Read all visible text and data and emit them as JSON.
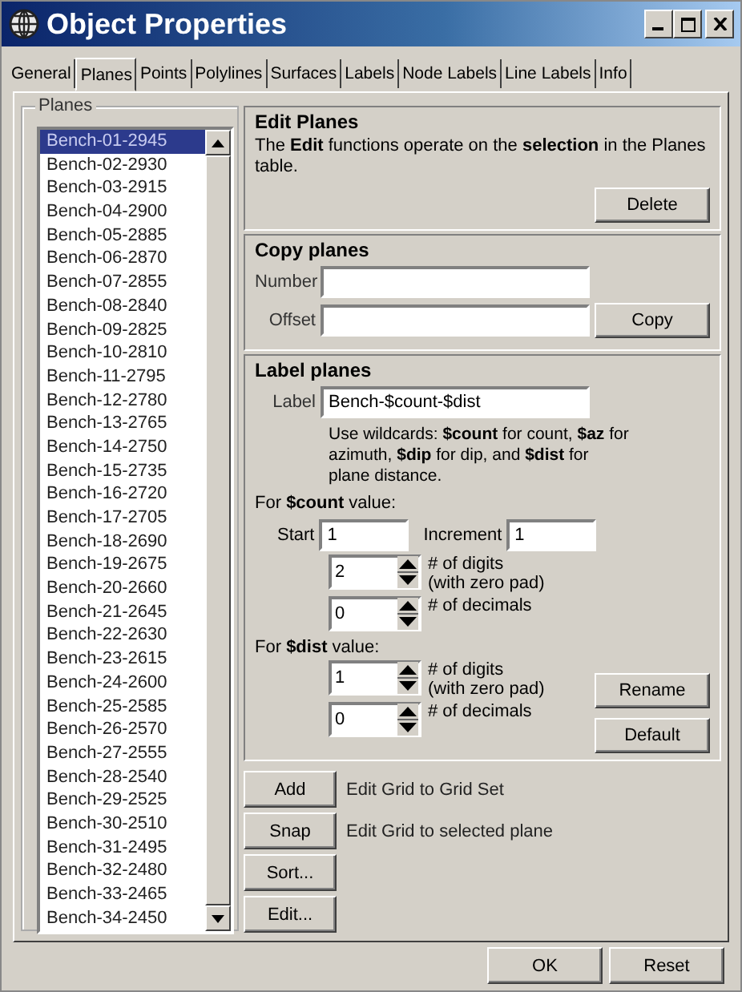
{
  "window": {
    "title": "Object Properties"
  },
  "tabs": [
    {
      "label": "General",
      "selected": false
    },
    {
      "label": "Planes",
      "selected": true
    },
    {
      "label": "Points",
      "selected": false
    },
    {
      "label": "Polylines",
      "selected": false
    },
    {
      "label": "Surfaces",
      "selected": false
    },
    {
      "label": "Labels",
      "selected": false
    },
    {
      "label": "Node Labels",
      "selected": false
    },
    {
      "label": "Line Labels",
      "selected": false
    },
    {
      "label": "Info",
      "selected": false
    }
  ],
  "planes_group": {
    "title": "Planes",
    "items": [
      {
        "label": "Bench-01-2945",
        "selected": true
      },
      {
        "label": "Bench-02-2930",
        "selected": false
      },
      {
        "label": "Bench-03-2915",
        "selected": false
      },
      {
        "label": "Bench-04-2900",
        "selected": false
      },
      {
        "label": "Bench-05-2885",
        "selected": false
      },
      {
        "label": "Bench-06-2870",
        "selected": false
      },
      {
        "label": "Bench-07-2855",
        "selected": false
      },
      {
        "label": "Bench-08-2840",
        "selected": false
      },
      {
        "label": "Bench-09-2825",
        "selected": false
      },
      {
        "label": "Bench-10-2810",
        "selected": false
      },
      {
        "label": "Bench-11-2795",
        "selected": false
      },
      {
        "label": "Bench-12-2780",
        "selected": false
      },
      {
        "label": "Bench-13-2765",
        "selected": false
      },
      {
        "label": "Bench-14-2750",
        "selected": false
      },
      {
        "label": "Bench-15-2735",
        "selected": false
      },
      {
        "label": "Bench-16-2720",
        "selected": false
      },
      {
        "label": "Bench-17-2705",
        "selected": false
      },
      {
        "label": "Bench-18-2690",
        "selected": false
      },
      {
        "label": "Bench-19-2675",
        "selected": false
      },
      {
        "label": "Bench-20-2660",
        "selected": false
      },
      {
        "label": "Bench-21-2645",
        "selected": false
      },
      {
        "label": "Bench-22-2630",
        "selected": false
      },
      {
        "label": "Bench-23-2615",
        "selected": false
      },
      {
        "label": "Bench-24-2600",
        "selected": false
      },
      {
        "label": "Bench-25-2585",
        "selected": false
      },
      {
        "label": "Bench-26-2570",
        "selected": false
      },
      {
        "label": "Bench-27-2555",
        "selected": false
      },
      {
        "label": "Bench-28-2540",
        "selected": false
      },
      {
        "label": "Bench-29-2525",
        "selected": false
      },
      {
        "label": "Bench-30-2510",
        "selected": false
      },
      {
        "label": "Bench-31-2495",
        "selected": false
      },
      {
        "label": "Bench-32-2480",
        "selected": false
      },
      {
        "label": "Bench-33-2465",
        "selected": false
      },
      {
        "label": "Bench-34-2450",
        "selected": false
      }
    ]
  },
  "edit_planes": {
    "title": "Edit Planes",
    "description": "The **Edit** functions operate on the **selection** in the Planes table.",
    "button": "Delete"
  },
  "copy_planes": {
    "title": "Copy planes",
    "fields": [
      {
        "label": "Number"
      },
      {
        "label": "Offset"
      }
    ],
    "button": "Copy"
  },
  "label_planes": {
    "title": "Label planes",
    "label_field": {
      "label": "Label",
      "value": "Bench-$count-$dist"
    },
    "help": "Use wildcards: **$count** for count, **$az** for azimuth, **$dip** for dip, and **$dist** for plane distance.",
    "count_heading": "For **$count** value:",
    "start": {
      "label": "Start",
      "value": "1"
    },
    "increment": {
      "label": "Increment",
      "value": "1"
    },
    "count_spinners": [
      {
        "value": "2",
        "label": "# of digits",
        "note": "(with zero pad)"
      },
      {
        "value": "0",
        "label": "# of decimals"
      }
    ],
    "dist_heading": "For **$dist** value:",
    "dist_spinners": [
      {
        "value": "1",
        "label": "# of digits",
        "note": "(with zero pad)"
      },
      {
        "value": "0",
        "label": "# of decimals"
      }
    ],
    "buttons": [
      "Rename",
      "Default"
    ]
  },
  "actions": [
    {
      "button": "Add",
      "description": "Edit Grid to Grid Set"
    },
    {
      "button": "Snap",
      "description": "Edit Grid to selected plane"
    },
    {
      "button": "Sort..."
    },
    {
      "button": "Edit..."
    }
  ],
  "dialog_buttons": [
    "OK",
    "Reset"
  ]
}
